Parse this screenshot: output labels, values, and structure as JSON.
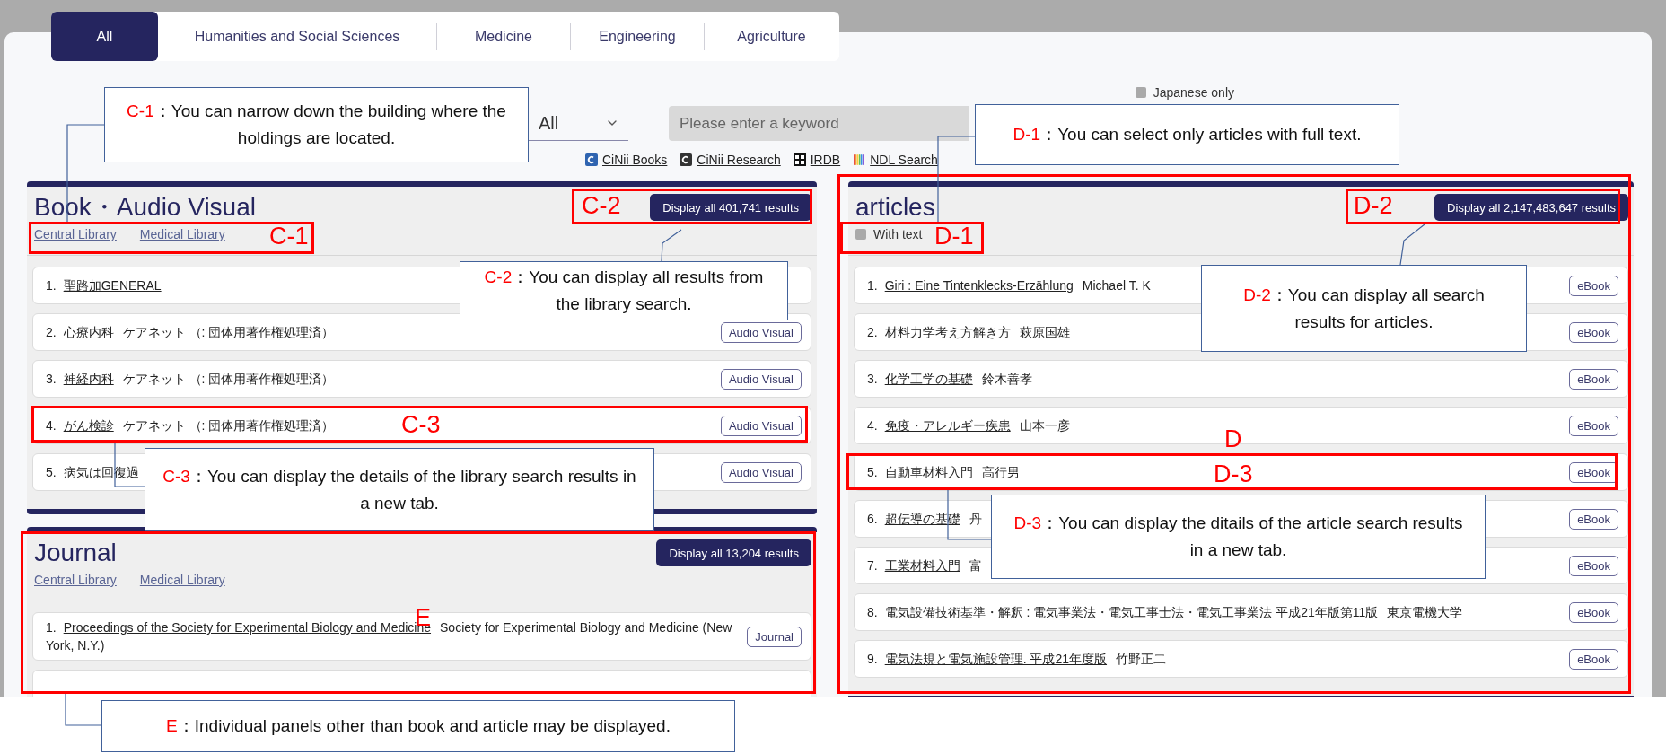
{
  "tabs": [
    {
      "label": "All",
      "selected": true
    },
    {
      "label": "Humanities and Social Sciences",
      "selected": false
    },
    {
      "label": "Medicine",
      "selected": false
    },
    {
      "label": "Engineering",
      "selected": false
    },
    {
      "label": "Agriculture",
      "selected": false
    }
  ],
  "search": {
    "japanese_only": {
      "label": "Japanese only",
      "checked": false
    },
    "scope": "All",
    "placeholder": "Please enter a keyword"
  },
  "external_links": [
    {
      "kind": "cinii",
      "label": "CiNii Books"
    },
    {
      "kind": "research",
      "label": "CiNii Research"
    },
    {
      "kind": "irdb",
      "label": "IRDB"
    },
    {
      "kind": "ndl",
      "label": "NDL Search"
    }
  ],
  "left_panels": [
    {
      "title": "Book・Audio Visual",
      "display_all": "Display all 401,741 results",
      "libraries": [
        "Central Library",
        "Medical Library"
      ],
      "cut_row": false,
      "items": [
        {
          "number": "1.",
          "title": "聖路加GENERAL"
        },
        {
          "number": "2.",
          "title": "心療内科",
          "author": "ケアネット （: 団体用著作権処理済）",
          "badge": "Audio Visual"
        },
        {
          "number": "3.",
          "title": "神経内科",
          "author": "ケアネット （: 団体用著作権処理済）",
          "badge": "Audio Visual"
        },
        {
          "number": "4.",
          "title": "がん検診",
          "author": "ケアネット （: 団体用著作権処理済）",
          "badge": "Audio Visual"
        },
        {
          "number": "5.",
          "title": "病気は回復過",
          "badge": "Audio Visual"
        }
      ]
    },
    {
      "title": "Journal",
      "display_all": "Display all 13,204 results",
      "libraries": [
        "Central Library",
        "Medical Library"
      ],
      "cut_row": true,
      "items": [
        {
          "number": "1.",
          "title": "Proceedings of the Society for Experimental Biology and Medicine",
          "author": "Society for Experimental Biology and Medicine (New York, N.Y.)",
          "badge": "Journal"
        }
      ]
    }
  ],
  "right_panel": {
    "title": "articles",
    "display_all": "Display all 2,147,483,647 results",
    "filter": {
      "label": "With text",
      "checked": false
    },
    "items": [
      {
        "number": "1.",
        "title": "Giri : Eine Tintenklecks-Erzählung",
        "author": "Michael T. K",
        "badge": "eBook"
      },
      {
        "number": "2.",
        "title": "材料力学考え方解き方",
        "author": "萩原国雄",
        "badge": "eBook"
      },
      {
        "number": "3.",
        "title": "化学工学の基礎",
        "author": "鈴木善孝",
        "badge": "eBook"
      },
      {
        "number": "4.",
        "title": "免疫・アレルギー疾患",
        "author": "山本一彦",
        "badge": "eBook"
      },
      {
        "number": "5.",
        "title": "自動車材料入門",
        "author": "高行男",
        "badge": "eBook"
      },
      {
        "number": "6.",
        "title": "超伝導の基礎",
        "author": "丹",
        "badge": "eBook"
      },
      {
        "number": "7.",
        "title": "工業材料入門",
        "author": "富",
        "badge": "eBook"
      },
      {
        "number": "8.",
        "title": "電気設備技術基準・解釈 : 電気事業法・電気工事士法・電気工事業法 平成21年版第11版",
        "author": "東京電機大学",
        "badge": "eBook"
      },
      {
        "number": "9.",
        "title": "電気法規と電気施設管理. 平成21年度版",
        "author": "竹野正二",
        "badge": "eBook"
      }
    ]
  },
  "frames": [
    {
      "label": "C-1"
    },
    {
      "label": "C-2"
    },
    {
      "label": "C-3"
    },
    {
      "label": "E"
    },
    {
      "label": "D"
    },
    {
      "label": "D-1"
    },
    {
      "label": "D-2"
    },
    {
      "label": "D-3"
    }
  ],
  "callouts": [
    {
      "label": "C-1",
      "text": "：You can narrow down the building where the holdings are located."
    },
    {
      "label": "C-2",
      "text": "：You can display all results from the library search."
    },
    {
      "label": "C-3",
      "text": "：You can display the details of the library search results in a new tab."
    },
    {
      "label": "D-1",
      "text": "：You can select only articles with full text."
    },
    {
      "label": "D-2",
      "text": "：You can display all search results for articles."
    },
    {
      "label": "D-3",
      "text": "：You can display the ditails of the article search results in a new tab."
    },
    {
      "label": "E",
      "text": "：Individual panels other than book and article may be displayed."
    }
  ]
}
